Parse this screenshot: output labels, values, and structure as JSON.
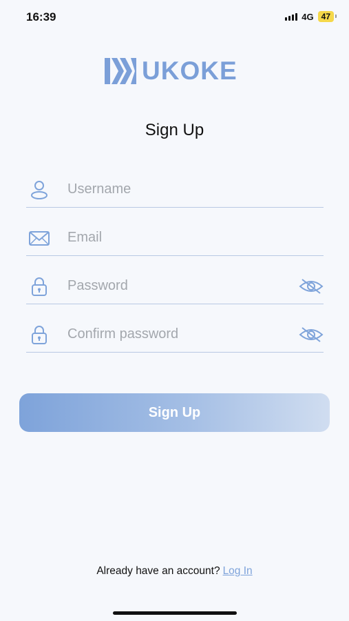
{
  "status_bar": {
    "time": "16:39",
    "network": "4G",
    "battery": "47"
  },
  "logo": {
    "text": "UKOKE",
    "icon": "ukoke-logo-icon"
  },
  "title": "Sign Up",
  "form": {
    "username": {
      "placeholder": "Username",
      "value": "",
      "icon": "user-icon"
    },
    "email": {
      "placeholder": "Email",
      "value": "",
      "icon": "envelope-icon"
    },
    "password": {
      "placeholder": "Password",
      "value": "",
      "icon": "lock-icon",
      "toggle_icon": "eye-icon"
    },
    "confirm_password": {
      "placeholder": "Confirm password",
      "value": "",
      "icon": "lock-icon",
      "toggle_icon": "eye-icon"
    }
  },
  "submit_label": "Sign Up",
  "footer": {
    "prompt": "Already have an account?",
    "link": "Log In"
  },
  "colors": {
    "accent": "#7b9fd8",
    "background": "#f6f8fc",
    "battery": "#f5d84a"
  }
}
